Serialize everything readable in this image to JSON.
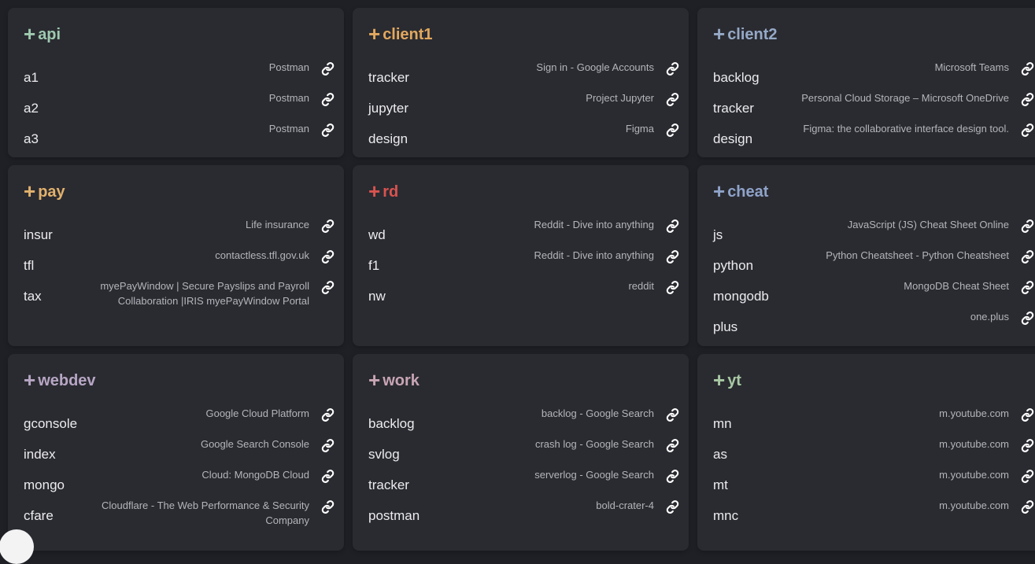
{
  "colors": {
    "background": "#1f2026",
    "card": "#2a2b31",
    "link_text": "#ececee",
    "desc_text": "#b3b5bb",
    "icon": "#ffffff"
  },
  "cards": [
    {
      "title": "api",
      "color": "#9fc9b0",
      "row": 1,
      "links": [
        {
          "name": "a1",
          "desc": "Postman",
          "icon": "link-icon"
        },
        {
          "name": "a2",
          "desc": "Postman",
          "icon": "link-icon"
        },
        {
          "name": "a3",
          "desc": "Postman",
          "icon": "link-icon"
        }
      ]
    },
    {
      "title": "client1",
      "color": "#e2a85e",
      "row": 1,
      "links": [
        {
          "name": "tracker",
          "desc": "Sign in - Google Accounts",
          "icon": "link-icon"
        },
        {
          "name": "jupyter",
          "desc": "Project Jupyter",
          "icon": "link-icon"
        },
        {
          "name": "design",
          "desc": "Figma",
          "icon": "link-icon"
        }
      ]
    },
    {
      "title": "client2",
      "color": "#95a9c6",
      "row": 1,
      "links": [
        {
          "name": "backlog",
          "desc": "Microsoft Teams",
          "icon": "link-icon"
        },
        {
          "name": "tracker",
          "desc": "Personal Cloud Storage – Microsoft OneDrive",
          "icon": "link-icon"
        },
        {
          "name": "design",
          "desc": "Figma: the collaborative interface design tool.",
          "icon": "link-icon"
        }
      ]
    },
    {
      "title": "pay",
      "color": "#e2b16c",
      "row": 2,
      "links": [
        {
          "name": "insur",
          "desc": "Life insurance",
          "icon": "link-icon"
        },
        {
          "name": "tfl",
          "desc": "contactless.tfl.gov.uk",
          "icon": "link-icon"
        },
        {
          "name": "tax",
          "desc": "myePayWindow | Secure Payslips and Payroll Collaboration |IRIS myePayWindow Portal",
          "icon": "link-icon"
        }
      ]
    },
    {
      "title": "rd",
      "color": "#d9534f",
      "row": 2,
      "links": [
        {
          "name": "wd",
          "desc": "Reddit - Dive into anything",
          "icon": "link-icon"
        },
        {
          "name": "f1",
          "desc": "Reddit - Dive into anything",
          "icon": "link-icon"
        },
        {
          "name": "nw",
          "desc": "reddit",
          "icon": "link-icon"
        }
      ]
    },
    {
      "title": "cheat",
      "color": "#8fa3c9",
      "row": 2,
      "links": [
        {
          "name": "js",
          "desc": "JavaScript (JS) Cheat Sheet Online",
          "icon": "link-icon"
        },
        {
          "name": "python",
          "desc": "Python Cheatsheet - Python Cheatsheet",
          "icon": "link-icon"
        },
        {
          "name": "mongodb",
          "desc": "MongoDB Cheat Sheet",
          "icon": "link-icon"
        },
        {
          "name": "plus",
          "desc": "one.plus",
          "icon": "link-icon"
        }
      ]
    },
    {
      "title": "webdev",
      "color": "#b7a6c4",
      "row": 3,
      "links": [
        {
          "name": "gconsole",
          "desc": "Google Cloud Platform",
          "icon": "link-icon"
        },
        {
          "name": "index",
          "desc": "Google Search Console",
          "icon": "link-icon"
        },
        {
          "name": "mongo",
          "desc": "Cloud: MongoDB Cloud",
          "icon": "link-icon"
        },
        {
          "name": "cfare",
          "desc": "Cloudflare - The Web Performance & Security Company",
          "icon": "link-icon"
        }
      ]
    },
    {
      "title": "work",
      "color": "#c8a5b4",
      "row": 3,
      "links": [
        {
          "name": "backlog",
          "desc": "backlog - Google Search",
          "icon": "link-icon"
        },
        {
          "name": "svlog",
          "desc": "crash log - Google Search",
          "icon": "link-icon"
        },
        {
          "name": "tracker",
          "desc": "serverlog - Google Search",
          "icon": "link-icon"
        },
        {
          "name": "postman",
          "desc": "bold-crater-4",
          "icon": "link-icon"
        }
      ]
    },
    {
      "title": "yt",
      "color": "#a8c9a4",
      "row": 3,
      "links": [
        {
          "name": "mn",
          "desc": "m.youtube.com",
          "icon": "link-icon"
        },
        {
          "name": "as",
          "desc": "m.youtube.com",
          "icon": "link-icon"
        },
        {
          "name": "mt",
          "desc": "m.youtube.com",
          "icon": "link-icon"
        },
        {
          "name": "mnc",
          "desc": "m.youtube.com",
          "icon": "link-icon"
        }
      ]
    }
  ]
}
